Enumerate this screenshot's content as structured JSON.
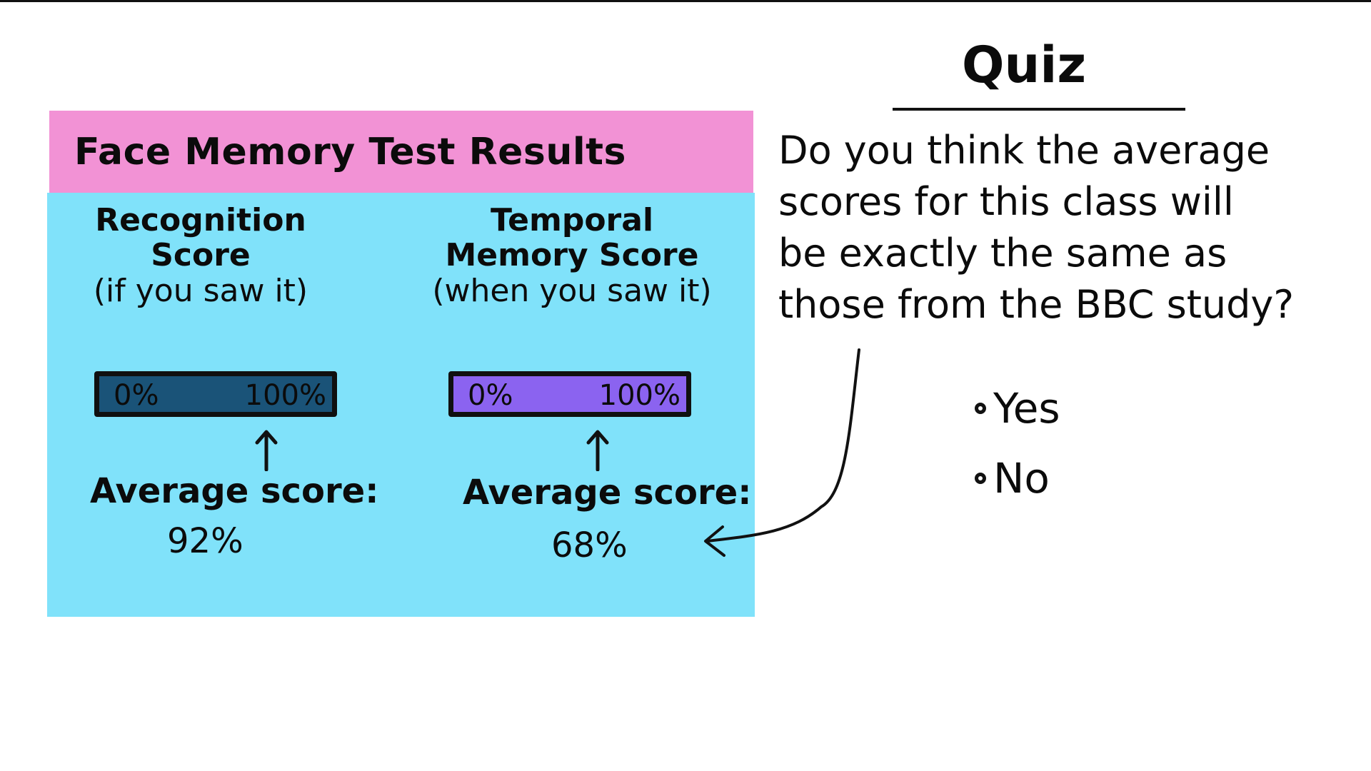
{
  "results_card": {
    "title": "Face Memory Test Results",
    "header_color": "#f292d5",
    "body_color": "#80e2fa",
    "metrics": [
      {
        "label_line1": "Recognition",
        "label_line2": "Score",
        "label_sub": "(if you saw it)",
        "scale_min": "0%",
        "scale_max": "100%",
        "bar_color": "#1a5378",
        "average_label": "Average score:",
        "average_value": "92%"
      },
      {
        "label_line1": "Temporal",
        "label_line2": "Memory Score",
        "label_sub": "(when you saw it)",
        "scale_min": "0%",
        "scale_max": "100%",
        "bar_color": "#8b63f0",
        "average_label": "Average score:",
        "average_value": "68%"
      }
    ]
  },
  "quiz": {
    "title": "Quiz",
    "question_lines": [
      "Do you think the average",
      "scores for this class will",
      "be exactly the same as",
      "those from the BBC study?"
    ],
    "options": [
      {
        "label": "Yes",
        "selected": false
      },
      {
        "label": "No",
        "selected": false
      }
    ]
  }
}
